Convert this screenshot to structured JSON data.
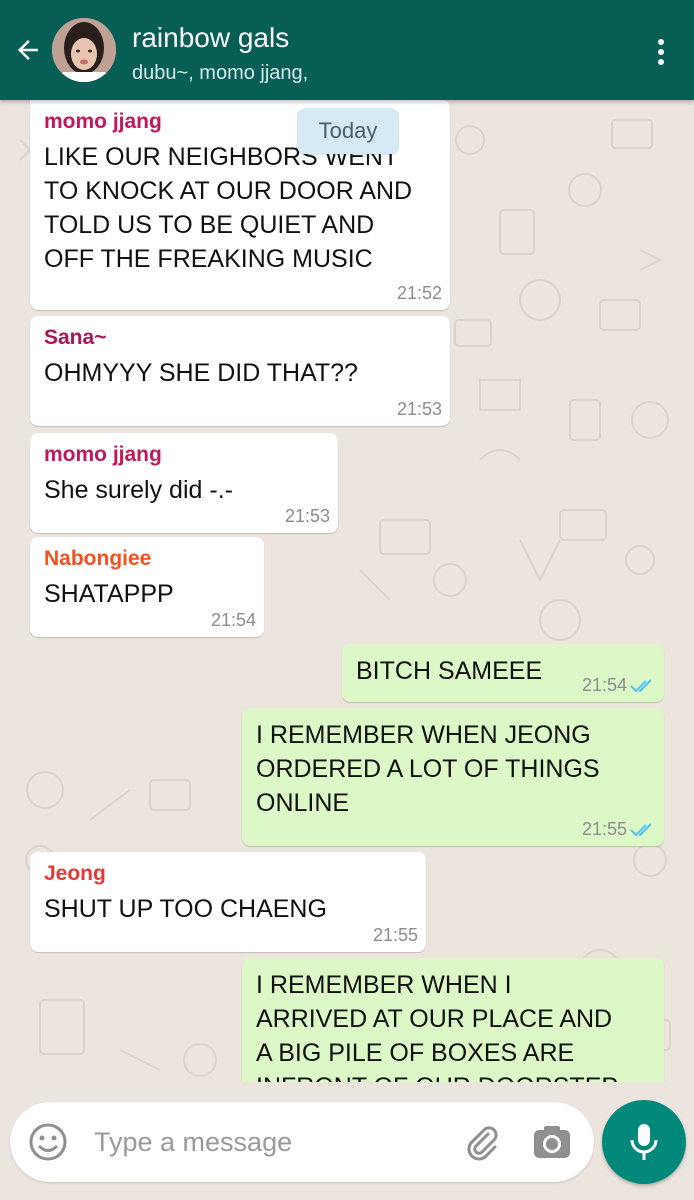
{
  "header": {
    "title": "rainbow gals",
    "subtitle": "dubu~, momo jjang,"
  },
  "date_pill": "Today",
  "messages": [
    {
      "direction": "in",
      "sender": "momo jjang",
      "sender_color": "#c2185b",
      "text": "LIKE OUR NEIGHBORS WENT\nTO KNOCK AT OUR DOOR AND\nTOLD US TO BE QUIET AND\nOFF THE FREAKING MUSIC",
      "time": "21:52"
    },
    {
      "direction": "in",
      "sender": "Sana~",
      "sender_color": "#ad1457",
      "text": "OHMYYY SHE DID THAT??",
      "time": "21:53"
    },
    {
      "direction": "in",
      "sender": "momo jjang",
      "sender_color": "#c2185b",
      "text": "She surely did -.-",
      "time": "21:53"
    },
    {
      "direction": "in",
      "sender": "Nabongiee",
      "sender_color": "#f4511e",
      "text": "SHATAPPP",
      "time": "21:54"
    },
    {
      "direction": "out",
      "text": "BITCH SAMEEE",
      "time": "21:54",
      "read": true
    },
    {
      "direction": "out",
      "text": "I REMEMBER WHEN JEONG\nORDERED A LOT OF THINGS\nONLINE",
      "time": "21:55",
      "read": true
    },
    {
      "direction": "in",
      "sender": "Jeong",
      "sender_color": "#e53935",
      "text": "SHUT UP TOO CHAENG",
      "time": "21:55"
    },
    {
      "direction": "out",
      "text": "I REMEMBER WHEN I\nARRIVED AT OUR PLACE AND\nA BIG PILE OF BOXES ARE\nINFRONT OF OUR DOORSTEP",
      "time": "",
      "read": false
    }
  ],
  "composer": {
    "placeholder": "Type a message"
  },
  "colors": {
    "header": "#075e54",
    "incoming": "#ffffff",
    "outgoing": "#dcf8c6",
    "mic": "#00897b",
    "read_ticks": "#4fc3f7"
  },
  "icons": [
    "back-arrow-icon",
    "more-vert-icon",
    "emoji-icon",
    "attach-icon",
    "camera-icon",
    "mic-icon",
    "double-check-icon"
  ]
}
